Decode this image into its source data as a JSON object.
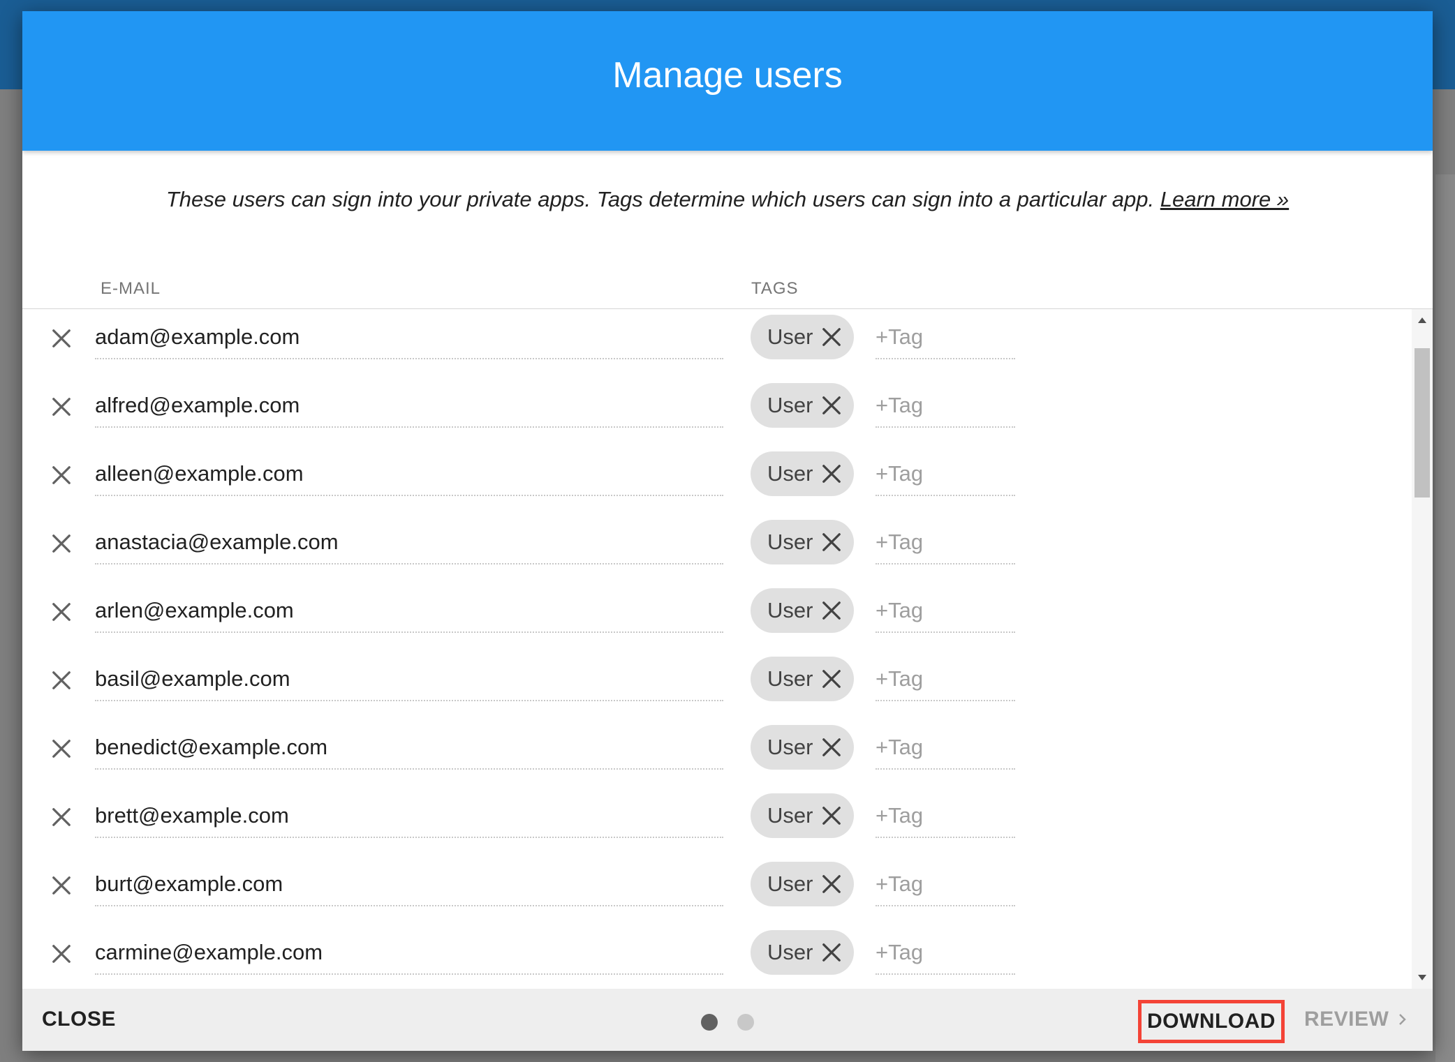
{
  "dialog": {
    "title": "Manage users",
    "intro_text": "These users can sign into your private apps. Tags determine which users can sign into a particular app.",
    "learn_more": "Learn more »"
  },
  "columns": {
    "email": "E-MAIL",
    "tags": "TAGS"
  },
  "tag_placeholder": "+Tag",
  "users": [
    {
      "email": "adam@example.com",
      "tag": "User"
    },
    {
      "email": "alfred@example.com",
      "tag": "User"
    },
    {
      "email": "alleen@example.com",
      "tag": "User"
    },
    {
      "email": "anastacia@example.com",
      "tag": "User"
    },
    {
      "email": "arlen@example.com",
      "tag": "User"
    },
    {
      "email": "basil@example.com",
      "tag": "User"
    },
    {
      "email": "benedict@example.com",
      "tag": "User"
    },
    {
      "email": "brett@example.com",
      "tag": "User"
    },
    {
      "email": "burt@example.com",
      "tag": "User"
    },
    {
      "email": "carmine@example.com",
      "tag": "User"
    }
  ],
  "footer": {
    "close_label": "CLOSE",
    "download_label": "DOWNLOAD",
    "review_label": "REVIEW",
    "page_count": 2,
    "current_page": 1
  },
  "colors": {
    "header_blue": "#2196f3",
    "highlight_red": "#f44336",
    "chip_grey": "#e0e0e0"
  },
  "icons": {
    "row_remove": "close-icon",
    "chip_remove": "close-icon",
    "review_next": "chevron-right-icon"
  }
}
